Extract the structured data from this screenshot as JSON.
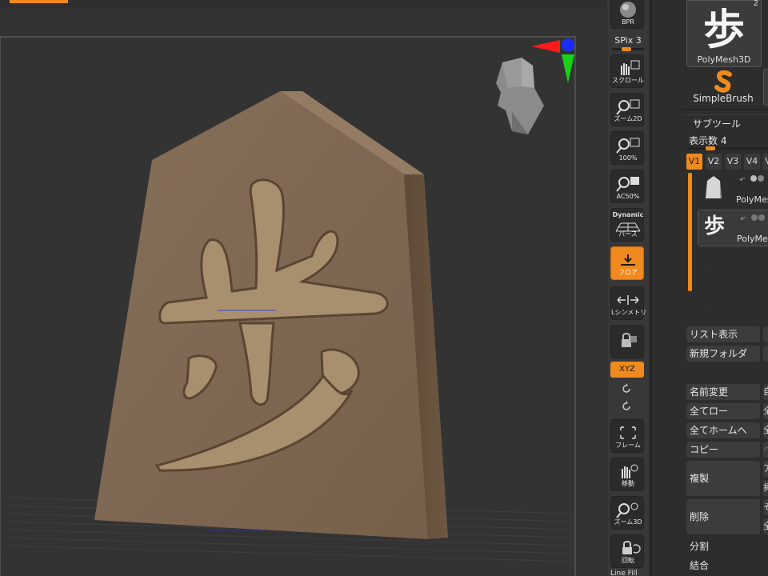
{
  "shelf": {
    "bpr_label": "BPR",
    "spix_label": "SPix 3",
    "scroll_label": "スクロール",
    "zoom2d_label": "ズーム2D",
    "actual_label": "100%",
    "aahalf_label": "AC50%",
    "dynamic_label": "Dynamic",
    "persp_label": "パース",
    "floor_label": "フロア",
    "lsym_label": "Lシンメトリ",
    "xyz_label": "XYZ",
    "frame_label": "フレーム",
    "move_label": "移動",
    "zoom3d_label": "ズーム3D",
    "rotate_label": "回転",
    "linefill_label": "Line Fill"
  },
  "panel": {
    "tool_glyph": "歩",
    "tool_count": "2",
    "tool_name": "PolyMesh3D",
    "brush_name": "SimpleBrush",
    "subtool_title": "サブツール",
    "visible_count_label": "表示数 4",
    "versions": [
      "V1",
      "V2",
      "V3",
      "V4",
      "V"
    ],
    "subtools": [
      {
        "name": "PolyMes"
      },
      {
        "name": "PolyMe",
        "glyph": "歩"
      }
    ],
    "list_view": "リスト表示",
    "new_folder": "新規フォルダ",
    "rename": "名前変更",
    "all_low": "全てロー",
    "all_home": "全てホームへ",
    "copy": "コピー",
    "duplicate": "複製",
    "delete": "削除",
    "split": "分割",
    "merge": "結合",
    "side_rename": "自",
    "side_alllow": "全",
    "side_allhome": "全",
    "side_copy": "ペ",
    "side_dup1": "ア",
    "side_dup2": "挿",
    "side_del1": "そ",
    "side_del2": "全"
  },
  "viewport": {
    "piece_glyph": "歩",
    "colors": {
      "piece_face": "#7d6650",
      "piece_side": "#6b5540",
      "carve": "#a48a70",
      "accent": "#f08a1e"
    }
  }
}
